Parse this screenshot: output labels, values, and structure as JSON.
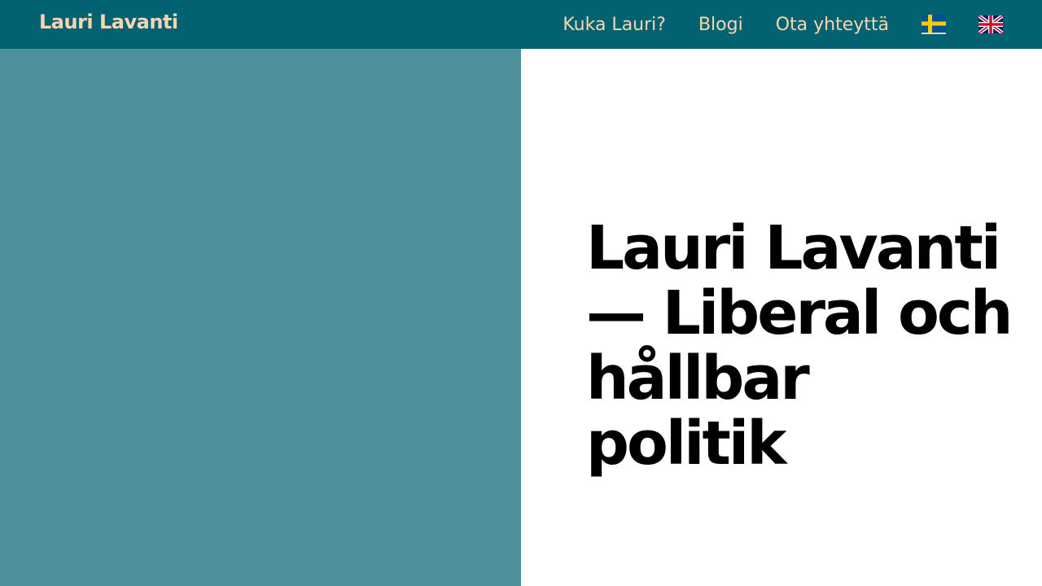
{
  "header": {
    "brand": "Lauri Lavanti",
    "nav": [
      {
        "label": "Kuka Lauri?"
      },
      {
        "label": "Blogi"
      },
      {
        "label": "Ota yhteyttä"
      }
    ],
    "languages": [
      {
        "icon": "swedish-flag-icon"
      },
      {
        "icon": "uk-flag-icon"
      }
    ]
  },
  "hero": {
    "headline": "Lauri Lavanti — Liberal och hållbar politik"
  },
  "colors": {
    "header_bg": "#036271",
    "header_text": "#f6d6b0",
    "panel_left": "#4e919b",
    "panel_right": "#ffffff",
    "headline": "#000000"
  }
}
